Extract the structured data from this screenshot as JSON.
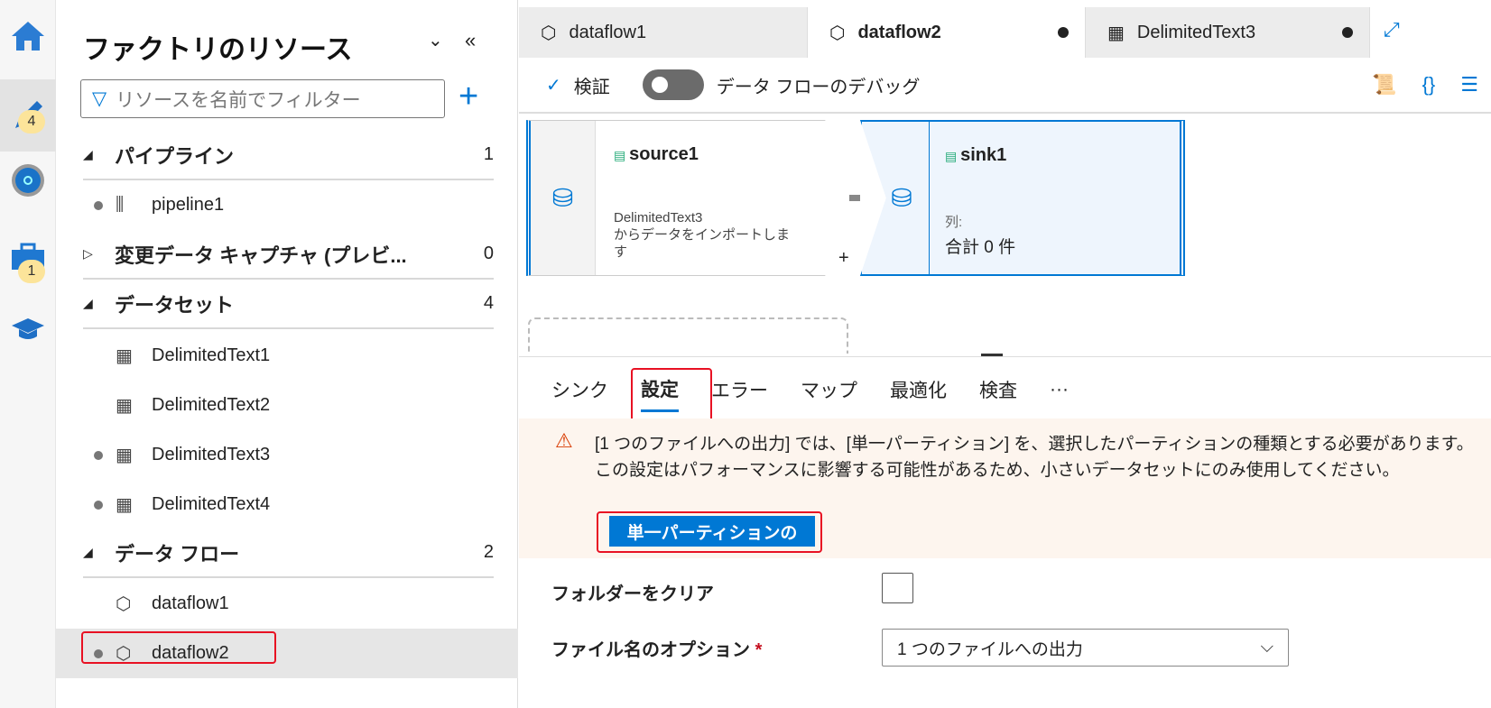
{
  "rail": {
    "items": [
      {
        "icon": "home-icon"
      },
      {
        "icon": "pencil-icon",
        "badge": "4"
      },
      {
        "icon": "monitor-icon"
      },
      {
        "icon": "toolbox-icon",
        "badge": "1"
      },
      {
        "icon": "learn-icon"
      }
    ]
  },
  "panel": {
    "title": "ファクトリのリソース",
    "filter_placeholder": "リソースを名前でフィルター",
    "sections": [
      {
        "label": "パイプライン",
        "count": "1",
        "items": [
          {
            "label": "pipeline1",
            "modified": true
          }
        ]
      },
      {
        "label": "変更データ キャプチャ (プレビ...",
        "count": "0",
        "items": []
      },
      {
        "label": "データセット",
        "count": "4",
        "items": [
          {
            "label": "DelimitedText1",
            "modified": false
          },
          {
            "label": "DelimitedText2",
            "modified": false
          },
          {
            "label": "DelimitedText3",
            "modified": true
          },
          {
            "label": "DelimitedText4",
            "modified": true
          }
        ]
      },
      {
        "label": "データ フロー",
        "count": "2",
        "items": [
          {
            "label": "dataflow1",
            "modified": false
          },
          {
            "label": "dataflow2",
            "modified": true
          }
        ]
      }
    ]
  },
  "tabs": [
    {
      "label": "dataflow1"
    },
    {
      "label": "dataflow2",
      "active": true,
      "modified": true
    },
    {
      "label": "DelimitedText3",
      "modified": true
    }
  ],
  "toolbar": {
    "validate": "検証",
    "debug": "データ フローのデバッグ",
    "debug_on": false
  },
  "canvas": {
    "source": {
      "name": "source1",
      "desc_1": "DelimitedText3",
      "desc_2": "からデータをインポートしま",
      "desc_3": "す"
    },
    "sink": {
      "name": "sink1",
      "col_label": "列:",
      "col_total": "合計 0 件"
    },
    "add": "+"
  },
  "subtabs": [
    "シンク",
    "設定",
    "エラー",
    "マップ",
    "最適化",
    "検査",
    "···"
  ],
  "warning": {
    "text": "[1 つのファイルへの出力] では、[単一パーティション] を、選択したパーティションの種類とする必要があります。この設定はパフォーマンスに影響する可能性があるため、小さいデータセットにのみ使用してください。",
    "button": "単一パーティションの"
  },
  "form": {
    "clear_folder": "フォルダーをクリア",
    "clear_folder_checked": false,
    "filename_option": "ファイル名のオプション",
    "required": "*",
    "filename_value": "1 つのファイルへの出力"
  },
  "colors": {
    "accent": "#0078d4",
    "highlight": "#e81123"
  }
}
